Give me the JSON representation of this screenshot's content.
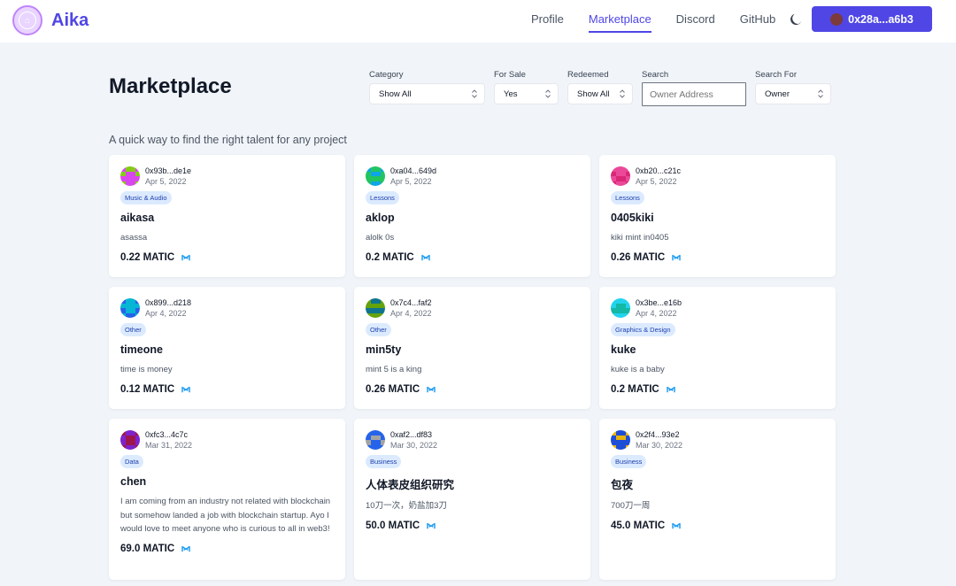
{
  "app": {
    "name": "Aika"
  },
  "nav": {
    "items": [
      {
        "label": "Profile",
        "active": false
      },
      {
        "label": "Marketplace",
        "active": true
      },
      {
        "label": "Discord",
        "active": false
      },
      {
        "label": "GitHub",
        "active": false
      }
    ],
    "theme_icon": "moon-icon",
    "wallet_label": "0x28a...a6b3"
  },
  "page": {
    "title": "Marketplace",
    "subtitle": "A quick way to find the right talent for any project"
  },
  "filters": {
    "category": {
      "label": "Category",
      "value": "Show All"
    },
    "for_sale": {
      "label": "For Sale",
      "value": "Yes"
    },
    "redeemed": {
      "label": "Redeemed",
      "value": "Show All"
    },
    "search": {
      "label": "Search",
      "placeholder": "Owner Address"
    },
    "search_for": {
      "label": "Search For",
      "value": "Owner"
    }
  },
  "cards": [
    {
      "owner": "0x93b...de1e",
      "date": "Apr 5, 2022",
      "category": "Music & Audio",
      "title": "aikasa",
      "description": "asassa",
      "price": "0.22 MATIC",
      "avatar_colors": [
        "#d946ef",
        "#84cc16"
      ]
    },
    {
      "owner": "0xa04...649d",
      "date": "Apr 5, 2022",
      "category": "Lessons",
      "title": "aklop",
      "description": "alolk 0s",
      "price": "0.2 MATIC",
      "avatar_colors": [
        "#22c55e",
        "#0ea5e9"
      ]
    },
    {
      "owner": "0xb20...c21c",
      "date": "Apr 5, 2022",
      "category": "Lessons",
      "title": "0405kiki",
      "description": "kiki mint in0405",
      "price": "0.26 MATIC",
      "avatar_colors": [
        "#ec4899",
        "#db2777"
      ]
    },
    {
      "owner": "0x899...d218",
      "date": "Apr 4, 2022",
      "category": "Other",
      "title": "timeone",
      "description": "time is money",
      "price": "0.12 MATIC",
      "avatar_colors": [
        "#06b6d4",
        "#2563eb"
      ]
    },
    {
      "owner": "0x7c4...faf2",
      "date": "Apr 4, 2022",
      "category": "Other",
      "title": "min5ty",
      "description": "mint 5 is a king",
      "price": "0.26 MATIC",
      "avatar_colors": [
        "#65a30d",
        "#0e7490"
      ]
    },
    {
      "owner": "0x3be...e16b",
      "date": "Apr 4, 2022",
      "category": "Graphics & Design",
      "title": "kuke",
      "description": "kuke is a baby",
      "price": "0.2 MATIC",
      "avatar_colors": [
        "#14b8a6",
        "#22d3ee"
      ]
    },
    {
      "owner": "0xfc3...4c7c",
      "date": "Mar 31, 2022",
      "category": "Data",
      "title": "chen",
      "description": "I am coming from an industry not related with blockchain but somehow landed a job with blockchain startup. Ayo I would love to meet anyone who is curious to all in web3!",
      "price": "69.0 MATIC",
      "avatar_colors": [
        "#9d174d",
        "#7e22ce"
      ]
    },
    {
      "owner": "0xaf2...df83",
      "date": "Mar 30, 2022",
      "category": "Business",
      "title": "人体表皮组织研究",
      "description": "10刀一次，奶盐加3刀",
      "price": "50.0 MATIC",
      "avatar_colors": [
        "#2563eb",
        "#a3a3a3"
      ]
    },
    {
      "owner": "0x2f4...93e2",
      "date": "Mar 30, 2022",
      "category": "Business",
      "title": "包夜",
      "description": "700刀一周",
      "price": "45.0 MATIC",
      "avatar_colors": [
        "#1d4ed8",
        "#eab308"
      ]
    }
  ],
  "colors": {
    "accent": "#4f46e5",
    "background": "#f1f5f9",
    "badge_bg": "#dbeafe",
    "badge_text": "#1e40af",
    "matic": "#1d9bf0"
  },
  "icons": [
    "logo-icon",
    "moon-icon",
    "chevron-updown-icon",
    "matic-icon"
  ]
}
